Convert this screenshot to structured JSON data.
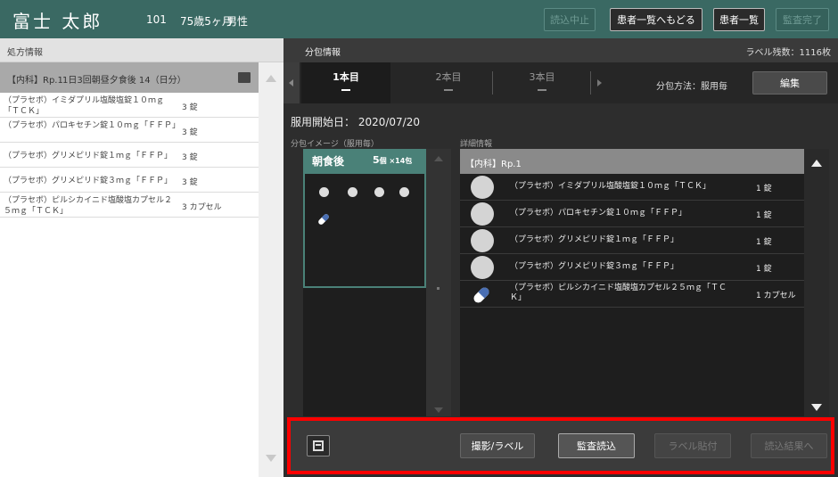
{
  "header": {
    "patient_name": "富士 太郎",
    "room": "101",
    "age": "75歳5ヶ月",
    "sex": "男性",
    "buttons": {
      "stop_reading": "読込中止",
      "back_to_list": "患者一覧へもどる",
      "patient_list": "患者一覧",
      "audit_complete": "監査完了"
    }
  },
  "left": {
    "title": "処方情報",
    "rp_label": "【内科】Rp.1",
    "rp_text": "1日3回朝昼夕食後 14（日分）",
    "items": [
      {
        "name": "（プラセボ）イミダプリル塩酸塩錠１０ｍｇ「ＴＣＫ」",
        "qty": "3 錠"
      },
      {
        "name": "（プラセボ）パロキセチン錠１０ｍｇ「ＦＦＰ」",
        "qty": "3 錠"
      },
      {
        "name": "（プラセボ）グリメピリド錠１ｍｇ「ＦＦＰ」",
        "qty": "3 錠"
      },
      {
        "name": "（プラセボ）グリメピリド錠３ｍｇ「ＦＦＰ」",
        "qty": "3 錠"
      },
      {
        "name": "（プラセボ）ピルシカイニド塩酸塩カプセル２５ｍｇ「ＴＣＫ」",
        "qty": "3 カプセル"
      }
    ]
  },
  "right": {
    "title": "分包情報",
    "label_count": "ラベル残数：1116枚",
    "tabs": [
      {
        "label": "1本目",
        "active": true
      },
      {
        "label": "2本目",
        "active": false
      },
      {
        "label": "3本目",
        "active": false
      }
    ],
    "pack_method": "分包方法：服用毎",
    "edit_label": "編集",
    "start_date": "服用開始日： 2020/07/20",
    "image_label": "分包イメージ（服用毎）",
    "detail_label": "詳細情報",
    "pack": {
      "timing": "朝食後",
      "count_main": "5",
      "count_unit": "個 ×14包",
      "tablet_count": 4,
      "capsule_count": 1
    },
    "detail": {
      "header": "【内科】Rp.1",
      "rows": [
        {
          "name": "（プラセボ）イミダプリル塩酸塩錠１０ｍｇ「ＴＣＫ」",
          "qty": "1 錠",
          "kind": "tablet"
        },
        {
          "name": "（プラセボ）パロキセチン錠１０ｍｇ「ＦＦＰ」",
          "qty": "1 錠",
          "kind": "tablet"
        },
        {
          "name": "（プラセボ）グリメピリド錠１ｍｇ「ＦＦＰ」",
          "qty": "1 錠",
          "kind": "tablet"
        },
        {
          "name": "（プラセボ）グリメピリド錠３ｍｇ「ＦＦＰ」",
          "qty": "1 錠",
          "kind": "tablet"
        },
        {
          "name": "（プラセボ）ピルシカイニド塩酸塩カプセル２５ｍｇ「ＴＣＫ」",
          "qty": "1 カプセル",
          "kind": "capsule"
        }
      ]
    },
    "actions": {
      "photo_label": "撮影/ラベル",
      "audit_read": "監査読込",
      "label_attach": "ラベル貼付",
      "to_results": "読込結果へ"
    }
  },
  "colors": {
    "header_bg": "#3a6963",
    "pack_accent": "#4a8178",
    "highlight": "#ff0000"
  }
}
